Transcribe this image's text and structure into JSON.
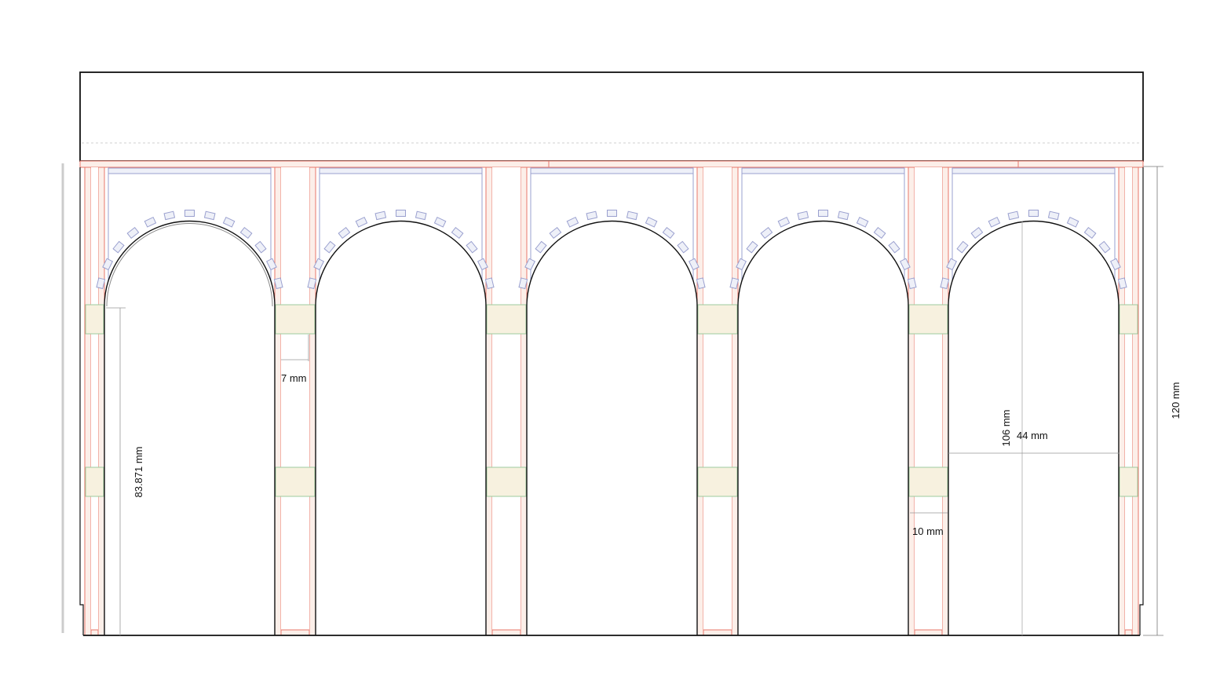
{
  "diagram": {
    "arch_count": 5,
    "colors": {
      "outline": "#111111",
      "frame": "#e8776a",
      "frame_fill": "#fcefe9",
      "voussoir": "#9aa0cf",
      "voussoir_fill": "#eef0f8",
      "block": "#9ccb9f",
      "block_fill": "#f7f1df",
      "dimension": "#777777",
      "guide": "#bbbbbb"
    },
    "dimensions": {
      "total_height": "120 mm",
      "opening_height": "106 mm",
      "opening_width": "44 mm",
      "pier_height": "83.871 mm",
      "pier_width": "7 mm",
      "pier_gap": "10 mm"
    }
  }
}
